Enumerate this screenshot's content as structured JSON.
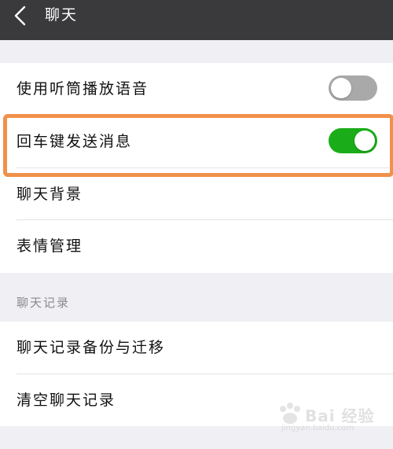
{
  "header": {
    "title": "聊天",
    "back_icon": "chevron-left-icon"
  },
  "settings": {
    "earpiece_audio": {
      "label": "使用听筒播放语音",
      "enabled": false
    },
    "enter_to_send": {
      "label": "回车键发送消息",
      "enabled": true
    },
    "chat_background": {
      "label": "聊天背景"
    },
    "sticker_management": {
      "label": "表情管理"
    }
  },
  "chat_history": {
    "section_title": "聊天记录",
    "backup_migrate": {
      "label": "聊天记录备份与迁移"
    },
    "clear_history": {
      "label": "清空聊天记录"
    }
  },
  "colors": {
    "topbar": "#3a3a3c",
    "toggle_on": "#1aad19",
    "toggle_off": "#a9a9a9",
    "highlight": "#f0914a"
  },
  "watermark": {
    "brand": "Bai 经验",
    "url": "jingyan.baidu.com"
  }
}
